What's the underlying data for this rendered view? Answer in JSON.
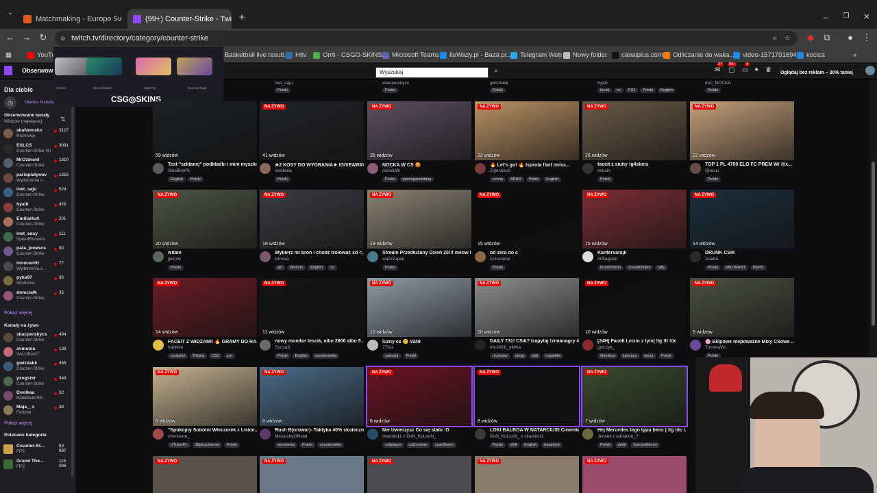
{
  "browser": {
    "tabs": [
      {
        "title": "Matchmaking - Europe 5v5 Qui",
        "favicon_color": "#e25a1c"
      },
      {
        "title": "(99+) Counter-Strike - Twitch",
        "favicon_color": "#9146ff"
      }
    ],
    "url": "twitch.tv/directory/category/counter-strike",
    "bookmarks": [
      {
        "label": "YouTube",
        "color": "#ff0000"
      },
      {
        "label": "Basketball live result...",
        "color": "#f0a500"
      },
      {
        "label": "Hltv",
        "color": "#2d6da3"
      },
      {
        "label": "Orrti - CSGO-SKINS...",
        "color": "#4caf50"
      },
      {
        "label": "Microsoft Teams",
        "color": "#6264a7"
      },
      {
        "label": "IleWazy.pl - Baza pr...",
        "color": "#1e88e5"
      },
      {
        "label": "Telegram Web",
        "color": "#29a9eb"
      },
      {
        "label": "Nowy folder",
        "color": "#bdbdbd"
      },
      {
        "label": "canalplus.com",
        "color": "#111111"
      },
      {
        "label": "Odliczanie do waka...",
        "color": "#f57c00"
      },
      {
        "label": "video-1571701694",
        "color": "#1e88e5"
      },
      {
        "label": "kocica",
        "color": "#1e88e5"
      }
    ]
  },
  "twitch": {
    "search_placeholder": "Wyszukaj",
    "following_label": "Obserwowane",
    "badges": [
      "37",
      "99+",
      "4"
    ],
    "promo": "Oglądaj bez reklam – 30% taniej"
  },
  "ad": {
    "brand": "CSG◎SKINS",
    "items": [
      "Stream",
      "Wave Breaker",
      "Bad Trip",
      "Searing Rage"
    ]
  },
  "sidebar": {
    "for_you": "Dla ciebie",
    "open_history": "Otwórz historię",
    "followed_header": "Obserwowane kanały",
    "followed_sort": "Widzów (najwięcej)",
    "followed": [
      {
        "name": "akaNemsko",
        "game": "Rozmowy",
        "viewers": "3127",
        "color": "#7a5c4a"
      },
      {
        "name": "ESLCS",
        "game": "Counter-Strike HIGHLIGHTS:...",
        "viewers": "3091",
        "color": "#2a2a2a"
      },
      {
        "name": "MrOzInold",
        "game": "Counter-Strike",
        "viewers": "1810",
        "color": "#54606b"
      },
      {
        "name": "parisplatynov",
        "game": "Wydarzenia s...",
        "viewers": "1316",
        "color": "#6b4a3a"
      },
      {
        "name": "inet_saju",
        "game": "Counter-Strike",
        "viewers": "524",
        "color": "#3e5f8a"
      },
      {
        "name": "byalli",
        "game": "Counter-Strike",
        "viewers": "429",
        "color": "#8a3b3b"
      },
      {
        "name": "EmiliaHult",
        "game": "Counter-Strike",
        "viewers": "201",
        "color": "#a86f5c"
      },
      {
        "name": "inet_easy",
        "game": "SpeedRunners",
        "viewers": "111",
        "color": "#3e6b4e"
      },
      {
        "name": "pata_jonescs",
        "game": "Counter-Strike",
        "viewers": "90",
        "color": "#6b5a8a"
      },
      {
        "name": "innocenttt",
        "game": "Wydarzenia s...",
        "viewers": "77",
        "color": "#4a4a4a"
      },
      {
        "name": "pyka97",
        "game": "Windrose",
        "viewers": "36",
        "color": "#7a6a40"
      },
      {
        "name": "domciafk",
        "game": "Counter-Strike",
        "viewers": "35",
        "color": "#905a7a"
      }
    ],
    "show_more": "Pokaż więcej",
    "live_header": "Kanały na żywo",
    "live": [
      {
        "name": "xkacperskycs",
        "game": "Counter-Strike",
        "viewers": "494",
        "color": "#5a4a3a"
      },
      {
        "name": "avmusia",
        "game": "VALORANT",
        "viewers": "138",
        "color": "#c06a7a"
      },
      {
        "name": "gwizdakk",
        "game": "Counter-Strike",
        "viewers": "468",
        "color": "#3a5a7a"
      },
      {
        "name": "yxngstxr",
        "game": "Counter-Strike",
        "viewers": "348",
        "color": "#4a6a4a"
      },
      {
        "name": "Doolkaa",
        "game": "Battlefield RE...",
        "viewers": "32",
        "color": "#7a4a6a"
      },
      {
        "name": "Maja__x",
        "game": "Fortnite",
        "viewers": "38",
        "color": "#8a7a5a"
      }
    ],
    "show_more2": "Pokaż więcej",
    "categories_header": "Polecane kategorie",
    "categories": [
      {
        "name": "Counter-St...",
        "game": "FPS",
        "viewers": "83 997",
        "color": "#c9a24a"
      },
      {
        "name": "Grand The...",
        "game": "FPS",
        "viewers": "115 086",
        "color": "#3a6a3a"
      }
    ]
  },
  "top_row": [
    {
      "name": "inet_saju",
      "tags": [
        "Polski"
      ]
    },
    {
      "name": "xkacperskycs",
      "tags": [
        "Polski"
      ]
    },
    {
      "name": "gwizdakk",
      "tags": [
        "Polski"
      ]
    },
    {
      "name": "byalli",
      "tags": [
        "faceit",
        "cs",
        "CS2",
        "Polski",
        "English"
      ]
    },
    {
      "name": "mrs_NOCKA",
      "tags": [
        "Polski"
      ]
    }
  ],
  "live_label": "NA ŻYWO",
  "streams": [
    {
      "title": "Test \"szklanej\" podkładki i mini myszki|...",
      "channel": "SkullBoyPL",
      "views": "59 widzów",
      "tags": [
        "English",
        "Polski"
      ],
      "bg": "#1c2126",
      "live": false,
      "avatar": "#5a5a5a"
    },
    {
      "title": "★2 KOSY DO WYGRANIA★ !GIVEAWAY...",
      "channel": "xwalkiria",
      "views": "41 widzów",
      "tags": [
        "Polski"
      ],
      "bg": "#202327",
      "live": true,
      "avatar": "#8a6a5a"
    },
    {
      "title": "NOCKA W CS 😡",
      "channel": "domciafk",
      "views": "35 widzów",
      "tags": [
        "Polski",
        "gamingandvibing"
      ],
      "bg": "#5a4f5f",
      "live": true,
      "avatar": "#905a7a"
    },
    {
      "title": "🔥 Let's go! 🔥 Ispruta !bot !miss...",
      "channel": "Zigeclorv2",
      "views": "32 widzów",
      "tags": [
        "senna",
        "ADHD",
        "Polski",
        "English"
      ],
      "bg": "#b99164",
      "live": true,
      "avatar": "#7a3a3a"
    },
    {
      "title": "faceit z siuhy !g4skins",
      "channel": "exusin",
      "views": "26 widzów",
      "tags": [
        "Polski"
      ],
      "bg": "#6a5a48",
      "live": true,
      "avatar": "#333333"
    },
    {
      "title": "TOP 1 PL 4700 ELO FC PREM W/ @x...",
      "channel": "Qlocuu",
      "views": "22 widzów",
      "tags": [
        "Polski"
      ],
      "bg": "#c4a07a",
      "live": true,
      "avatar": "#6a4a4a"
    },
    {
      "title": "witam",
      "channel": "jjulczix",
      "views": "20 widzów",
      "tags": [
        "Polski"
      ],
      "bg": "#4d5444",
      "live": true,
      "avatar": "#5a6a5a"
    },
    {
      "title": "Wybierz mi broń i chodź trolować xd <...",
      "channel": "k4rolax",
      "views": "19 widzów",
      "tags": [
        "girl",
        "Woman",
        "English",
        "cs"
      ],
      "bg": "#3a3c40",
      "live": true,
      "avatar": "#7a5a6a"
    },
    {
      "title": "Stream Przedłużany Dzień 20!!! meow l...",
      "channel": "wazzzupek",
      "views": "19 widzów",
      "tags": [
        "Polski"
      ],
      "bg": "#8a8374",
      "live": true,
      "avatar": "#4a7a8a"
    },
    {
      "title": "od zera do c",
      "channel": "sziruname",
      "views": "15 widzów",
      "tags": [
        "Polski"
      ],
      "bg": "#0c0c0c",
      "live": true,
      "avatar": "#8a6a4a"
    },
    {
      "title": "Kantersarajk",
      "channel": "driftagram",
      "views": "15 widzów",
      "tags": [
        "forzahorizon",
        "Grazwidzami",
        "rally"
      ],
      "bg": "#7a2e36",
      "live": true,
      "avatar": "#dddddd"
    },
    {
      "title": "DRUNK CSIK",
      "channel": "ziaaba",
      "views": "14 widzów",
      "tags": [
        "Polski",
        "VALORANT",
        "REPO"
      ],
      "bg": "#1c2e3c",
      "live": true,
      "avatar": "#2a2a2a"
    },
    {
      "title": "FACEIT Z WIDZAMI! 🔥 GRAMY DO RA...",
      "channel": "habitive",
      "views": "14 widzów",
      "tags": [
        "youtuber",
        "Polska",
        "CS2",
        "pro"
      ],
      "bg": "#6a1c26",
      "live": true,
      "avatar": "#e0c040"
    },
    {
      "title": "nowy monitor tescik, albo 2800 albo 5 ...",
      "channel": "SuczaS",
      "views": "11 widzów",
      "tags": [
        "Polski",
        "English",
        "counterstrike"
      ],
      "bg": "#141416",
      "live": true,
      "avatar": "#6a6a6a"
    },
    {
      "title": "luzny cs 😊 #249",
      "channel": "77isu",
      "views": "10 widzów",
      "tags": [
        "valorant",
        "Polski"
      ],
      "bg": "#8e99a4",
      "live": true,
      "avatar": "#bbbbbb"
    },
    {
      "title": "DAILY 731! CSik? Izapytaj !zmianagry #...",
      "channel": "mk1001l_eMKa",
      "views": "10 widzów",
      "tags": [
        "rozmowy",
        "akcja",
        "skill",
        "roguelike"
      ],
      "bg": "#8a8e8a",
      "live": true,
      "avatar": "#222222"
    },
    {
      "title": "[24H] FaceIt Lecim z tym| !lg !tt !dc",
      "channel": "gulczyk_",
      "views": "10 widzów",
      "tags": [
        "Omnibus",
        "kanciarz",
        "kocur",
        "Polski"
      ],
      "bg": "#0e0e10",
      "live": true,
      "avatar": "#8a2a2a"
    },
    {
      "title": "🌸 Ekipowe niepoważne Mixy CSowe ...",
      "channel": "TummaVic",
      "views": "9 widzów",
      "tags": [
        "Polski"
      ],
      "bg": "#4a5040",
      "live": true,
      "avatar": "#6a4a9a"
    },
    {
      "title": "\"Spokojny Sobotni Wieczorek z Liskie...",
      "channel": "shirosune_",
      "views": "8 widzów",
      "tags": [
        "VTuberPL",
        "18pluschannel",
        "Polski"
      ],
      "bg": "#c4b090",
      "live": true,
      "avatar": "#a04a4a"
    },
    {
      "title": "Rush B(orowar)- Taktyka 40% skuteczn...",
      "channel": "MissLettyOfficial",
      "views": "8 widzów",
      "tags": [
        "strzelanka",
        "Polski",
        "counterstrike"
      ],
      "bg": "#4a6a86",
      "live": true,
      "avatar": "#5a3a6a"
    },
    {
      "title": "Nie Uwierzysz Co się stało :O",
      "channel": "ckamils11 z DoN_KuLsoN_",
      "views": "8 widzów",
      "tags": [
        "cs2player",
        "cs2premier",
        "csgo2twich"
      ],
      "bg": "#6a1422",
      "live": true,
      "avatar": "#2a4a6a"
    },
    {
      "title": "LOKI BALBOA W NATARCIU!D Cinemka",
      "channel": "DoN_KuLsoN_ z ckamils11",
      "views": "8 widzów",
      "tags": [
        "Polski",
        "chill",
        "English",
        "headshot"
      ],
      "bg": "#101014",
      "live": true,
      "avatar": "#3a3a3a"
    },
    {
      "title": "Hej Mercedes tego typu benc | !lg !dc l...",
      "channel": "Jervieli z adrianoo_7",
      "views": "7 widzów",
      "tags": [
        "Polski",
        "debil",
        "SurvivalHorror"
      ],
      "bg": "#3a4a2e",
      "live": true,
      "avatar": "#6a6a3a"
    }
  ],
  "bottom_live": [
    "NA ŻYWO",
    "NA ŻYWO",
    "NA ŻYWO",
    "NA ŻYWO",
    "NA ŻYWO"
  ]
}
